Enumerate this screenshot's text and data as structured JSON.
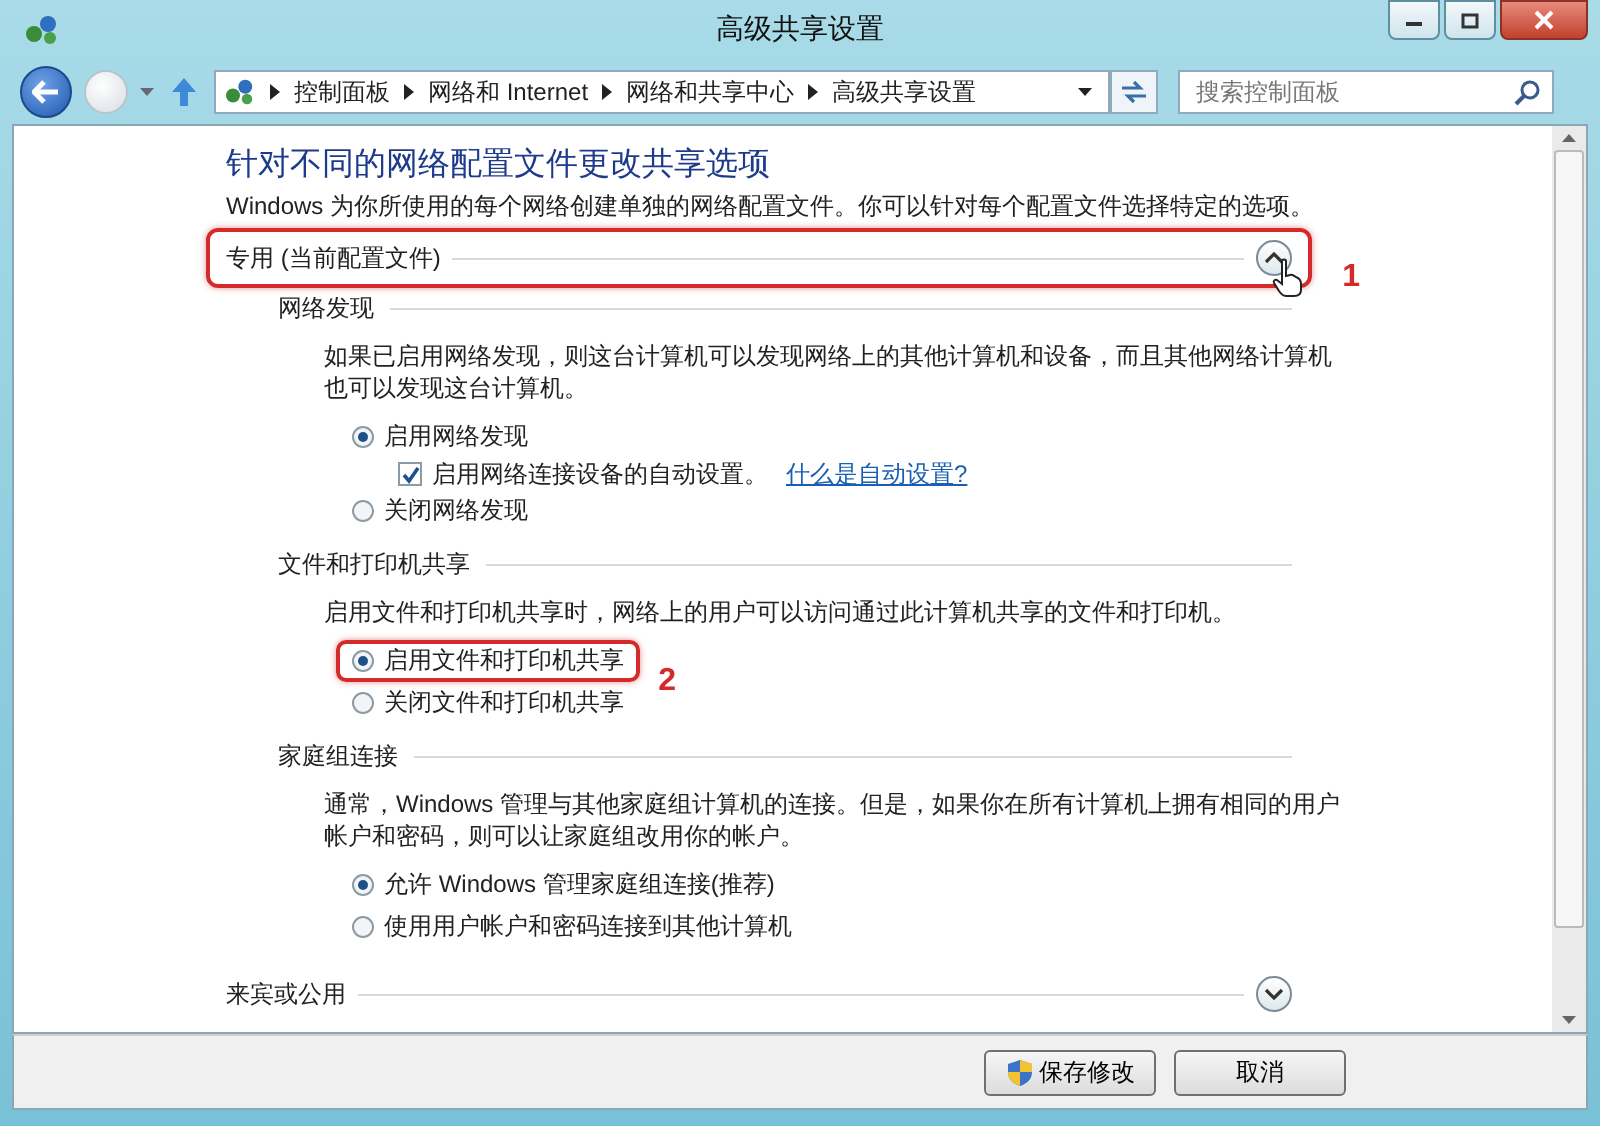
{
  "window": {
    "title": "高级共享设置"
  },
  "address_bar": {
    "path": [
      "控制面板",
      "网络和 Internet",
      "网络和共享中心",
      "高级共享设置"
    ]
  },
  "search": {
    "placeholder": "搜索控制面板"
  },
  "heading": "针对不同的网络配置文件更改共享选项",
  "description": "Windows 为你所使用的每个网络创建单独的网络配置文件。你可以针对每个配置文件选择特定的选项。",
  "profiles": [
    {
      "title": "专用 (当前配置文件)",
      "expanded": true,
      "annotation": "1",
      "sections": [
        {
          "title": "网络发现",
          "description": "如果已启用网络发现，则这台计算机可以发现网络上的其他计算机和设备，而且其他网络计算机也可以发现这台计算机。",
          "options": [
            {
              "kind": "radio",
              "label": "启用网络发现",
              "selected": true,
              "children": [
                {
                  "kind": "checkbox",
                  "label": "启用网络连接设备的自动设置。",
                  "checked": true,
                  "link": "什么是自动设置?"
                }
              ]
            },
            {
              "kind": "radio",
              "label": "关闭网络发现",
              "selected": false
            }
          ]
        },
        {
          "title": "文件和打印机共享",
          "description": "启用文件和打印机共享时，网络上的用户可以访问通过此计算机共享的文件和打印机。",
          "options": [
            {
              "kind": "radio",
              "label": "启用文件和打印机共享",
              "selected": true,
              "annotation": "2"
            },
            {
              "kind": "radio",
              "label": "关闭文件和打印机共享",
              "selected": false
            }
          ]
        },
        {
          "title": "家庭组连接",
          "description": "通常，Windows 管理与其他家庭组计算机的连接。但是，如果你在所有计算机上拥有相同的用户帐户和密码，则可以让家庭组改用你的帐户。",
          "options": [
            {
              "kind": "radio",
              "label": "允许 Windows 管理家庭组连接(推荐)",
              "selected": true
            },
            {
              "kind": "radio",
              "label": "使用用户帐户和密码连接到其他计算机",
              "selected": false
            }
          ]
        }
      ]
    },
    {
      "title": "来宾或公用",
      "expanded": false
    }
  ],
  "buttons": [
    {
      "label": "保存修改",
      "shield": true
    },
    {
      "label": "取消",
      "shield": false
    }
  ]
}
